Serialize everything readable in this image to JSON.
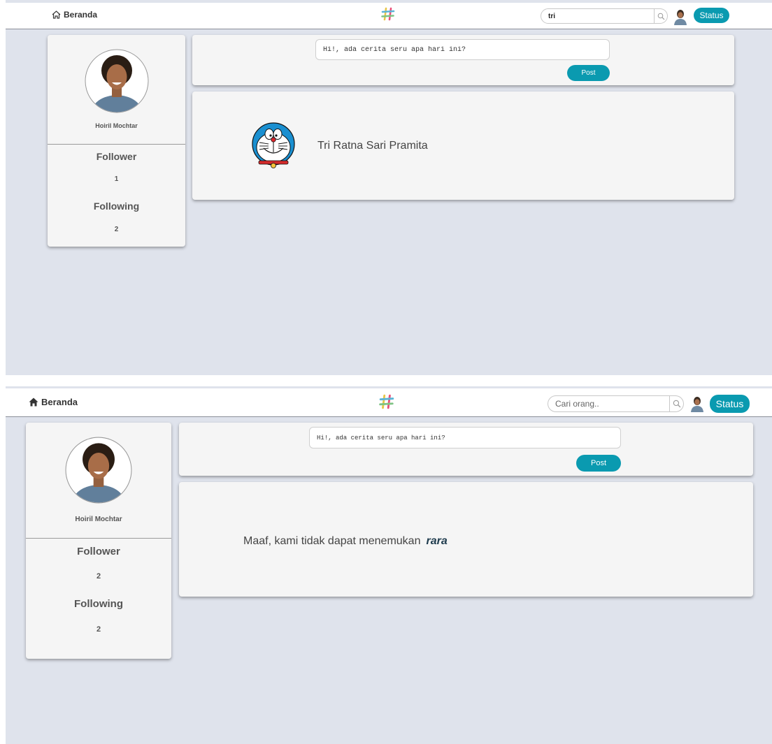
{
  "screens": [
    {
      "nav": {
        "home_label": "Beranda",
        "search_value": "tri",
        "search_placeholder": "Cari orang..",
        "status_label": "Status"
      },
      "profile": {
        "name": "Hoiril Mochtar",
        "follower_label": "Follower",
        "follower_count": "1",
        "following_label": "Following",
        "following_count": "2"
      },
      "composer": {
        "placeholder": "Hi!, ada cerita seru apa hari ini?",
        "post_label": "Post"
      },
      "result": {
        "type": "person",
        "name": "Tri Ratna Sari Pramita",
        "avatar_icon": "doraemon-avatar"
      }
    },
    {
      "nav": {
        "home_label": "Beranda",
        "search_value": "",
        "search_placeholder": "Cari orang..",
        "status_label": "Status"
      },
      "profile": {
        "name": "Hoiril Mochtar",
        "follower_label": "Follower",
        "follower_count": "2",
        "following_label": "Following",
        "following_count": "2"
      },
      "composer": {
        "placeholder": "Hi!, ada cerita seru apa hari ini?",
        "post_label": "Post"
      },
      "result": {
        "type": "not-found",
        "message": "Maaf, kami tidak dapat menemukan",
        "query": "rara"
      }
    }
  ],
  "colors": {
    "accent": "#0a9ab0",
    "page_bg": "#dfe3ec",
    "card_bg": "#f5f5f5",
    "query_text": "#1e3b4d"
  }
}
